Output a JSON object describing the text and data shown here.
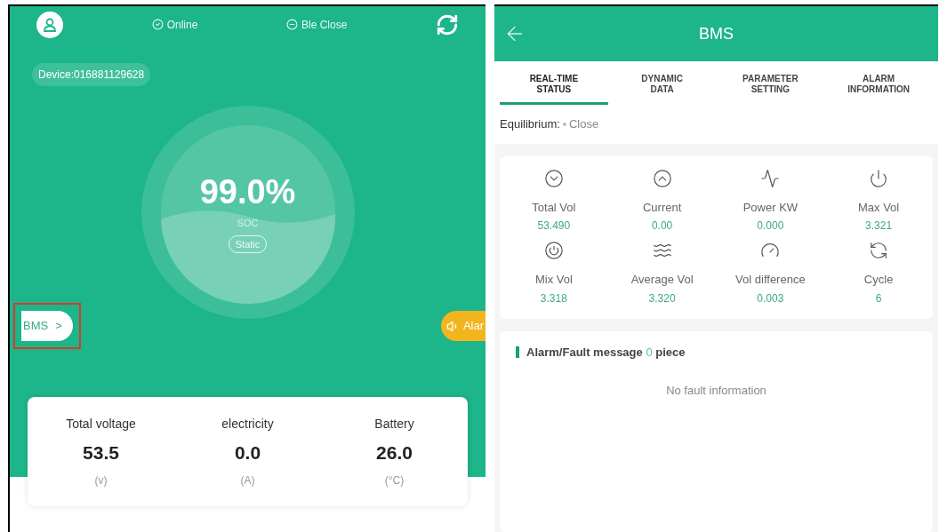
{
  "home": {
    "status": [
      {
        "label": "Online",
        "kind": "check"
      },
      {
        "label": "Ble Close",
        "kind": "minus"
      }
    ],
    "device": "Device:016881129628",
    "gauge": {
      "value": "99.0%",
      "label": "SOC",
      "state": "Static"
    },
    "bms_button": {
      "label": "BMS",
      "arrow": ">",
      "highlighted": true
    },
    "alarm_button": {
      "label": "Alar"
    },
    "metrics": [
      {
        "label": "Total voltage",
        "value": "53.5",
        "unit": "(v)"
      },
      {
        "label": "electricity",
        "value": "0.0",
        "unit": "(A)"
      },
      {
        "label": "Battery",
        "value": "26.0",
        "unit": "(°C)"
      }
    ]
  },
  "bms": {
    "title": "BMS",
    "tabs": [
      {
        "label": "REAL-TIME STATUS",
        "selected": true
      },
      {
        "label": "DYNAMIC DATA",
        "selected": false
      },
      {
        "label": "PARAMETER SETTING",
        "selected": false
      },
      {
        "label": "ALARM INFORMATION",
        "selected": false
      }
    ],
    "equilibrium": {
      "label": "Equilibrium:",
      "value": "Close"
    },
    "stats": [
      {
        "name": "Total Vol",
        "value": "53.490"
      },
      {
        "name": "Current",
        "value": "0.00"
      },
      {
        "name": "Power KW",
        "value": "0.000"
      },
      {
        "name": "Max Vol",
        "value": "3.321"
      },
      {
        "name": "Mix Vol",
        "value": "3.318"
      },
      {
        "name": "Average Vol",
        "value": "3.320"
      },
      {
        "name": "Vol difference",
        "value": "0.003"
      },
      {
        "name": "Cycle",
        "value": "6"
      }
    ],
    "alarm": {
      "title": "Alarm/Fault message **0** piece",
      "empty": "No fault information"
    }
  }
}
